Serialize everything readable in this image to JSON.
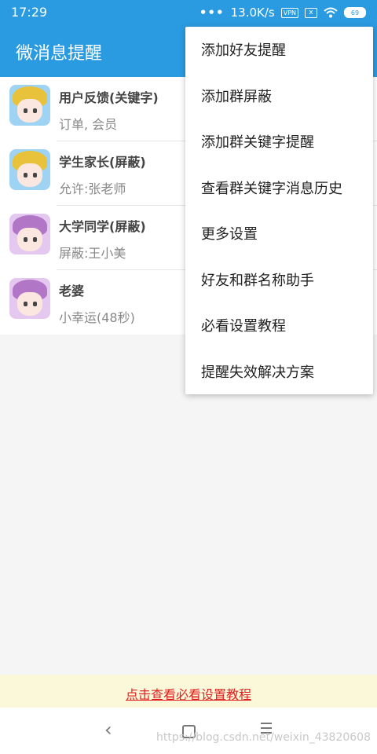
{
  "status_bar": {
    "time": "17:29",
    "dots": "•••",
    "speed": "13.0K/s",
    "vpn": "VPN",
    "sim": "x",
    "battery": "69"
  },
  "app_bar": {
    "title": "微消息提醒"
  },
  "contacts": [
    {
      "name": "用户反馈(关键字)",
      "subtitle": "订单, 会员",
      "avatar_color": "#9fd3f3"
    },
    {
      "name": "学生家长(屏蔽)",
      "subtitle": "允许:张老师",
      "avatar_color": "#9fd3f3"
    },
    {
      "name": "大学同学(屏蔽)",
      "subtitle": "屏蔽:王小美",
      "avatar_color": "#e4c8f0"
    },
    {
      "name": "老婆",
      "subtitle": "小幸运(48秒)",
      "avatar_color": "#e4c8f0"
    }
  ],
  "menu": {
    "items": [
      "添加好友提醒",
      "添加群屏蔽",
      "添加群关键字提醒",
      "查看群关键字消息历史",
      "更多设置",
      "好友和群名称助手",
      "必看设置教程",
      "提醒失效解决方案"
    ]
  },
  "footer": {
    "tutorial_link": "点击查看必看设置教程"
  },
  "nav_bar": {
    "back": "‹"
  },
  "watermark": "https://blog.csdn.net/weixin_43820608",
  "colors": {
    "primary": "#2a9be0",
    "banner_bg": "#fbf8da",
    "link": "#e02020"
  }
}
